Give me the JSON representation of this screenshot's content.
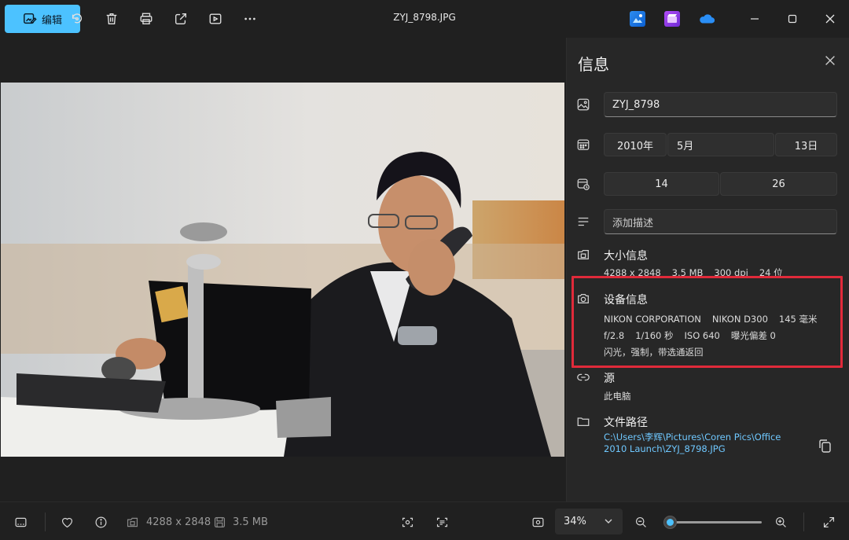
{
  "toolbar": {
    "edit_label": "编辑",
    "file_title": "ZYJ_8798.JPG"
  },
  "info": {
    "title": "信息",
    "file_name": "ZYJ_8798",
    "date": {
      "year": "2010年",
      "month": "5月",
      "day": "13日"
    },
    "time": {
      "hour": "14",
      "minute": "26"
    },
    "description_placeholder": "添加描述",
    "size": {
      "heading": "大小信息",
      "dimensions": "4288 x 2848",
      "filesize": "3.5 MB",
      "dpi": "300 dpi",
      "bit_depth": "24 位"
    },
    "device": {
      "heading": "设备信息",
      "maker": "NIKON CORPORATION",
      "model": "NIKON D300",
      "focal_length": "145 毫米",
      "aperture": "f/2.8",
      "shutter": "1/160 秒",
      "iso": "ISO 640",
      "exposure": "曝光偏差 0",
      "flash": "闪光，强制，带选通返回"
    },
    "source": {
      "heading": "源",
      "value": "此电脑"
    },
    "path": {
      "heading": "文件路径",
      "line1": "C:\\Users\\李辉\\Pictures\\Coren Pics\\Office",
      "line2": "2010 Launch\\ZYJ_8798.JPG"
    }
  },
  "status": {
    "dimensions": "4288 x 2848",
    "filesize": "3.5 MB",
    "zoom": "34%",
    "zoom_fraction": 0.06
  },
  "colors": {
    "accent": "#4cc2ff",
    "highlight": "#e02a3a",
    "link": "#6fc8ff"
  }
}
